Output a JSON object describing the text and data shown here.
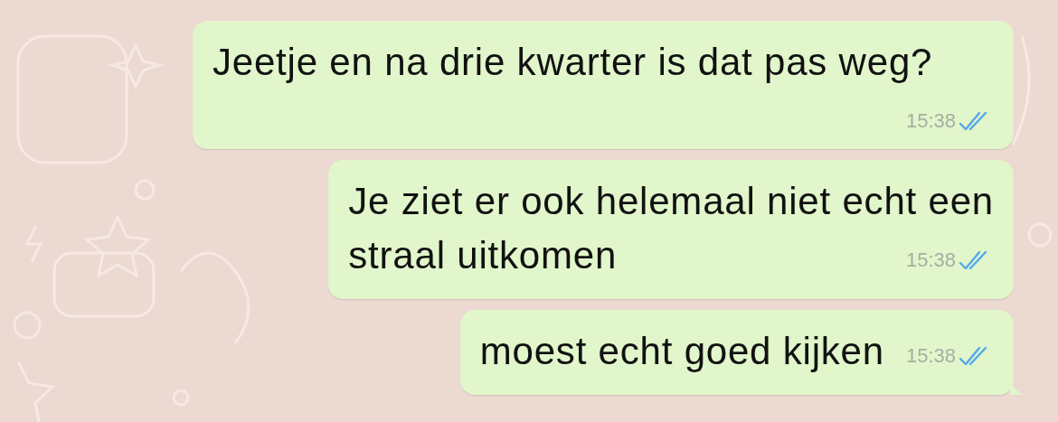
{
  "messages": [
    {
      "lines": [
        "Jeetje en na drie kwarter is dat pas weg?"
      ],
      "time": "15:38",
      "read": true,
      "tail": false
    },
    {
      "lines": [
        "Je ziet er ook helemaal niet echt een",
        "straal uitkomen"
      ],
      "time": "15:38",
      "read": true,
      "tail": false
    },
    {
      "lines": [
        "moest echt goed kijken"
      ],
      "time": "15:38",
      "read": true,
      "tail": true
    }
  ]
}
